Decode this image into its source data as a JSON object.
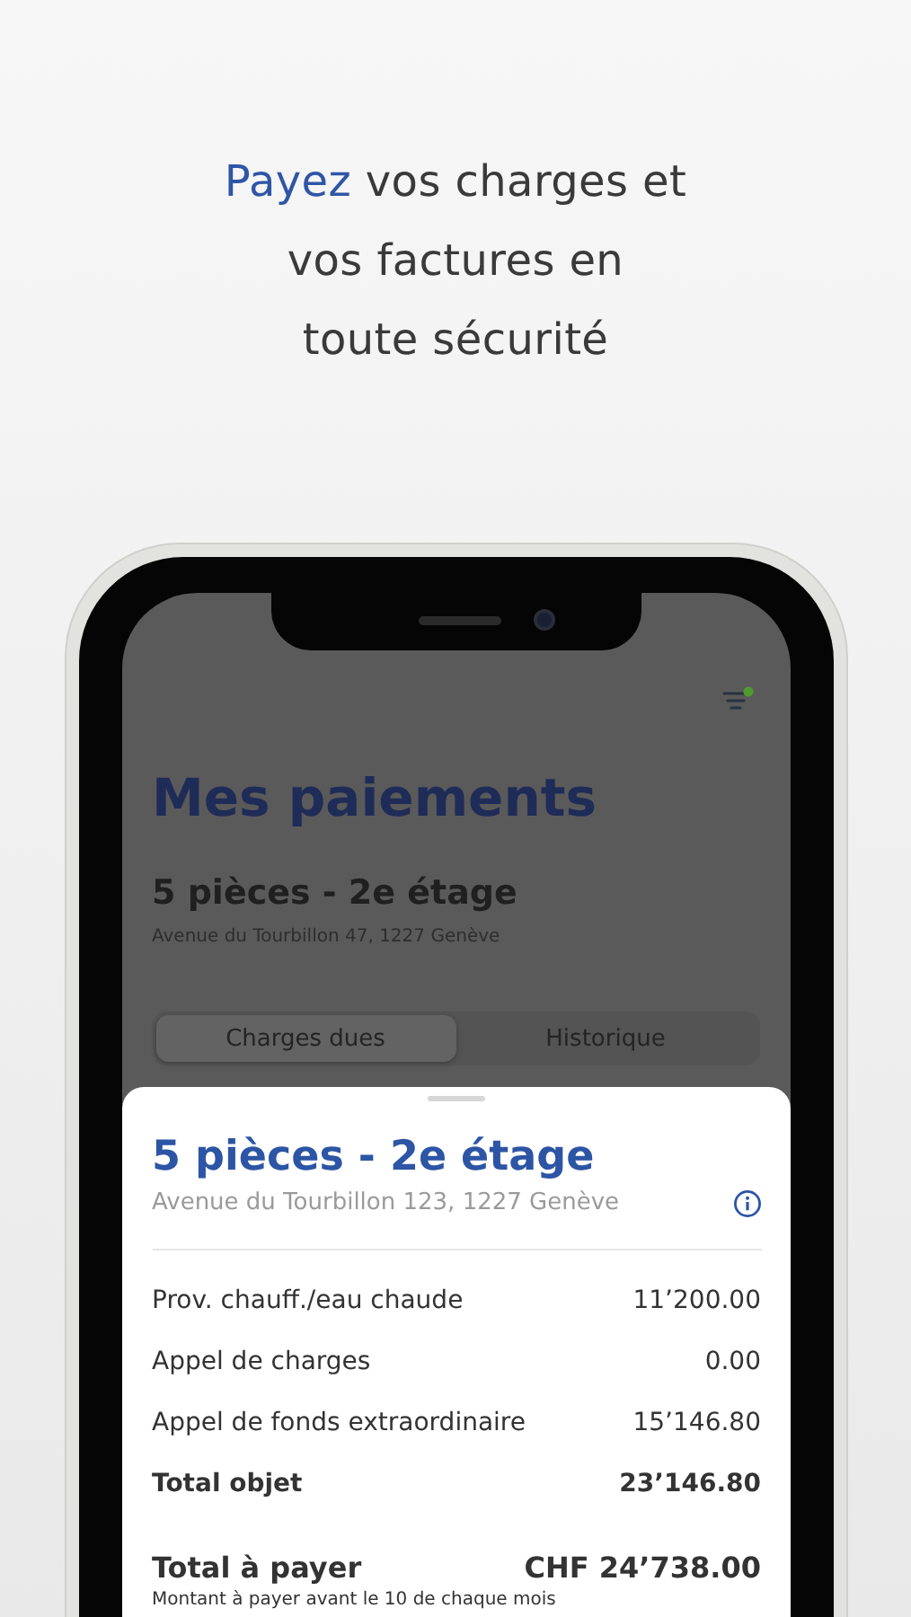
{
  "headline": {
    "accent": "Payez",
    "rest": " vos charges et vos factures en toute sécurité"
  },
  "screen": {
    "filter_active": true,
    "title": "Mes paiements",
    "property": "5 pièces - 2e étage",
    "address": "Avenue du Tourbillon 47, 1227 Genève",
    "tabs": [
      {
        "label": "Charges dues",
        "selected": true
      },
      {
        "label": "Historique",
        "selected": false
      }
    ]
  },
  "sheet": {
    "title": "5 pièces - 2e étage",
    "address": "Avenue du Tourbillon 123, 1227 Genève",
    "rows": [
      {
        "kind": "item",
        "label": "Prov. chauff./eau chaude",
        "amount": "11’200.00"
      },
      {
        "kind": "item",
        "label": "Appel de charges",
        "amount": "0.00"
      },
      {
        "kind": "item",
        "label": "Appel de fonds extraordinaire",
        "amount": "15’146.80"
      },
      {
        "kind": "subtotal",
        "label": "Total objet",
        "amount": "23’146.80"
      }
    ],
    "total": {
      "label": "Total à payer",
      "amount": "CHF 24’738.00"
    },
    "note": "Montant à payer avant le 10 de chaque mois"
  }
}
